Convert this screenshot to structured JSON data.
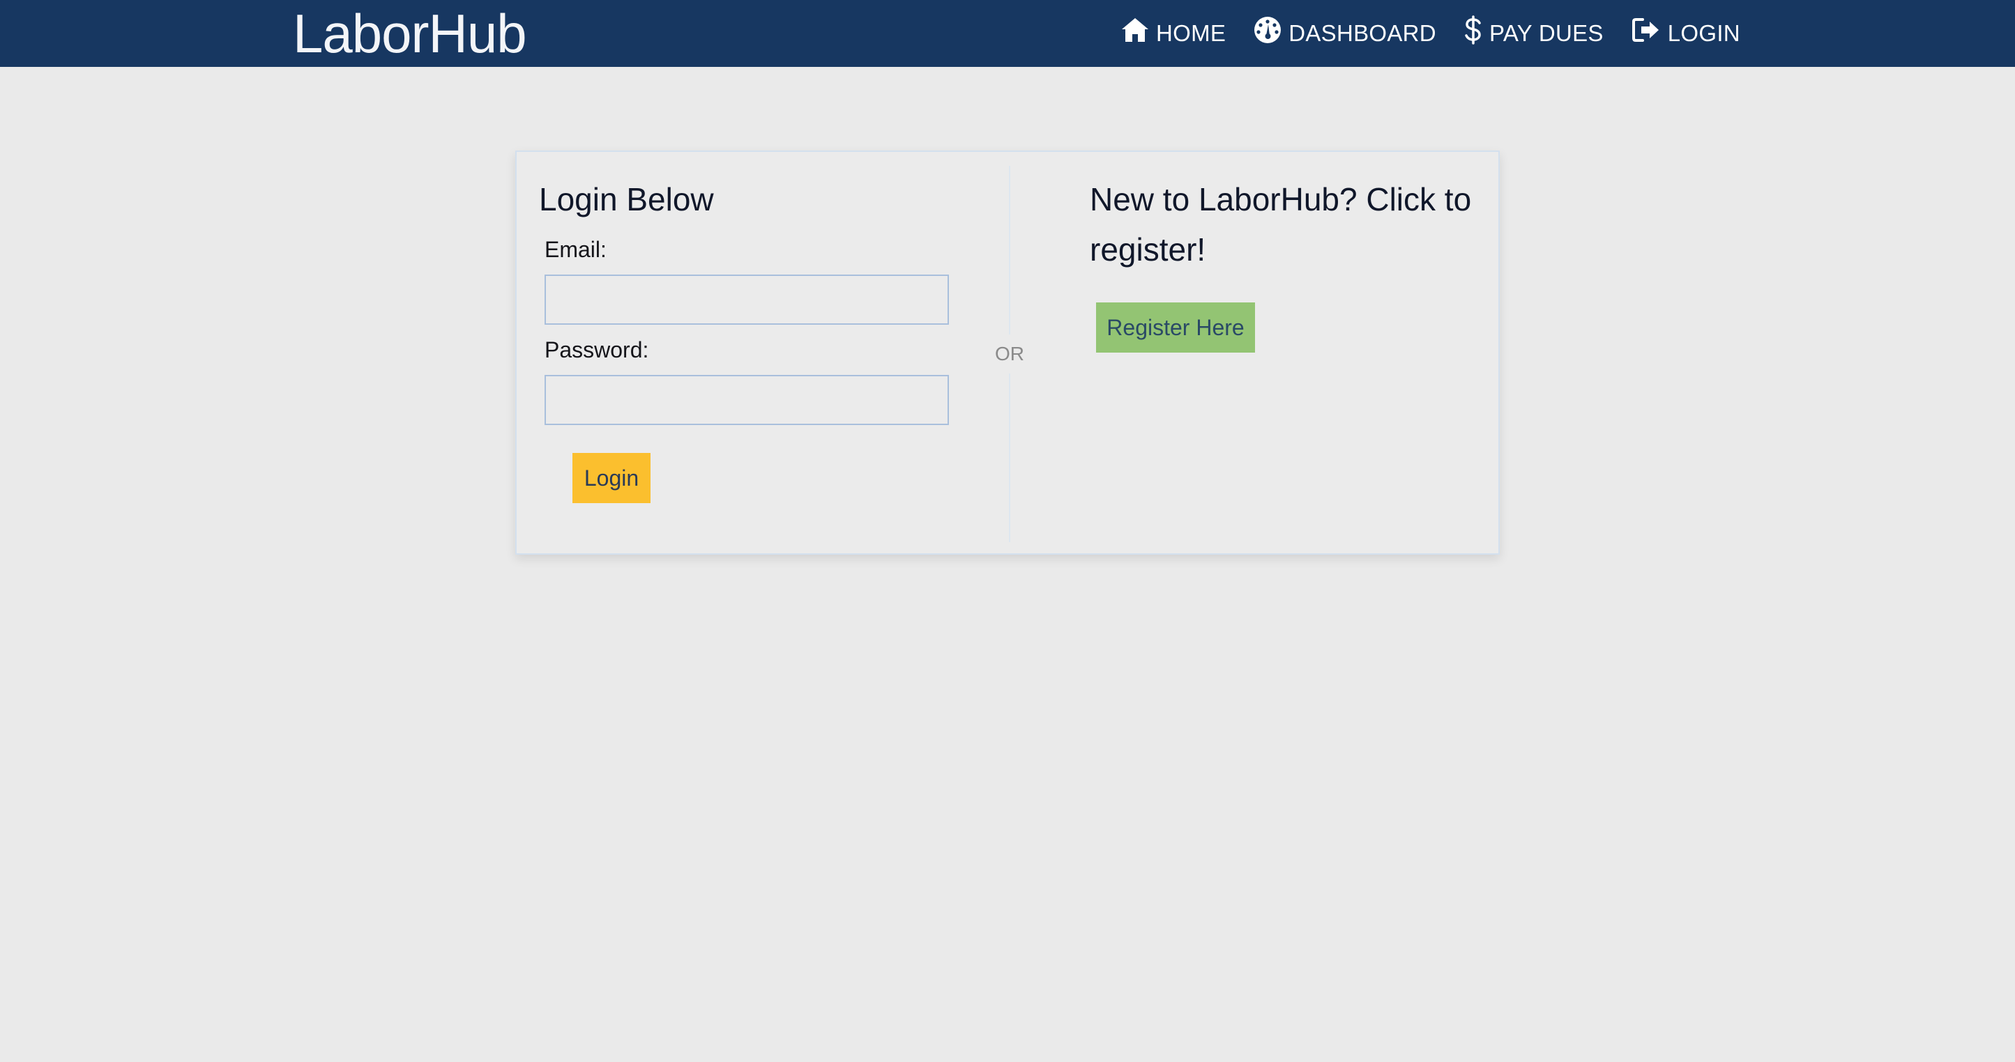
{
  "header": {
    "brand": "LaborHub",
    "nav": [
      {
        "icon": "home-icon",
        "label": "HOME"
      },
      {
        "icon": "dashboard-icon",
        "label": "DASHBOARD"
      },
      {
        "icon": "dollar-icon",
        "label": "PAY DUES"
      },
      {
        "icon": "login-icon",
        "label": "LOGIN"
      }
    ]
  },
  "login": {
    "title": "Login Below",
    "email_label": "Email:",
    "email_value": "",
    "password_label": "Password:",
    "password_value": "",
    "submit_label": "Login"
  },
  "divider": {
    "text": "OR"
  },
  "register": {
    "title": "New to LaborHub? Click to register!",
    "button_label": "Register Here"
  },
  "colors": {
    "navbar": "#173761",
    "page_background": "#eaeaea",
    "login_button": "#fbbf2e",
    "register_button": "#93c473"
  }
}
